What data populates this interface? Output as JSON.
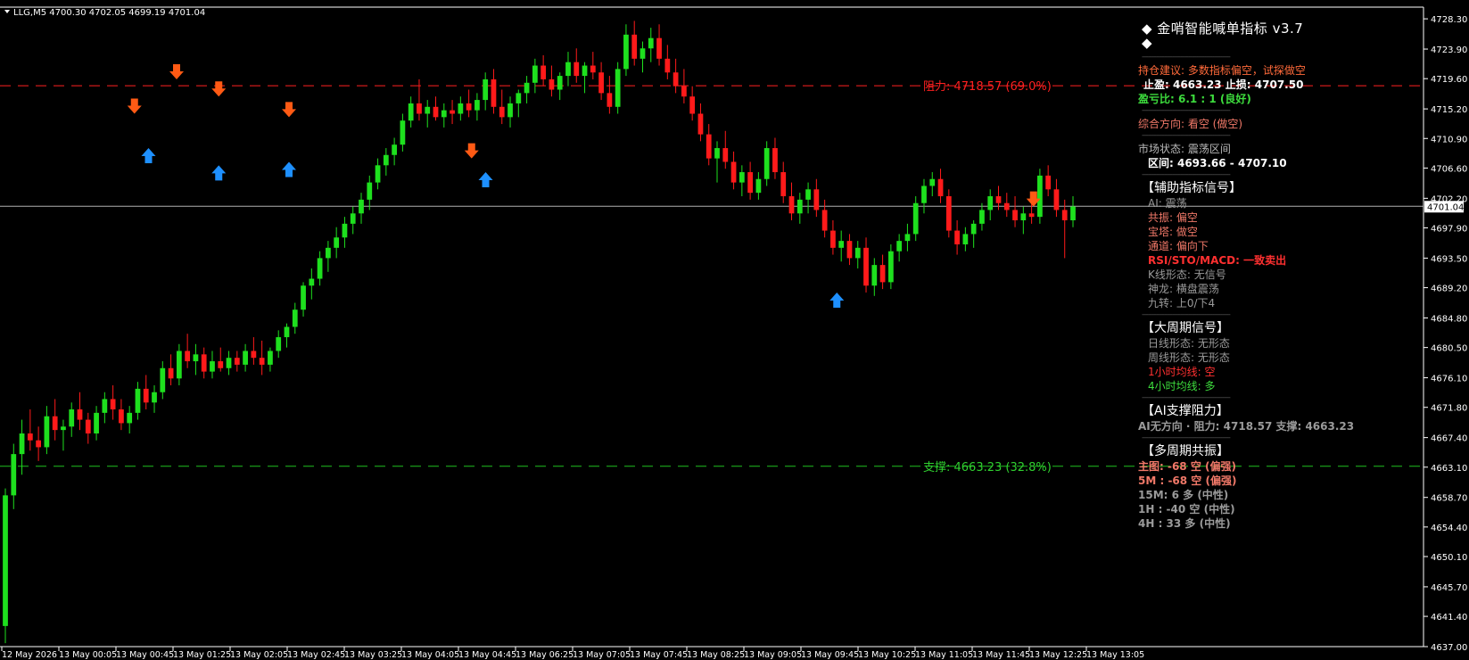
{
  "header": {
    "symbol_info": "LLG,M5  4700.30 4702.05 4699.19 4701.04"
  },
  "price_axis": {
    "ticks": [
      "4728.30",
      "4723.90",
      "4719.60",
      "4715.20",
      "4710.90",
      "4706.60",
      "4702.20",
      "4697.90",
      "4693.50",
      "4689.20",
      "4684.80",
      "4680.50",
      "4676.10",
      "4671.80",
      "4667.40",
      "4663.10",
      "4658.70",
      "4654.40",
      "4650.10",
      "4645.70",
      "4641.40",
      "4637.00"
    ],
    "current_price_label": "4701.04"
  },
  "time_axis": {
    "labels": [
      "12 May 2026",
      "13 May 00:05",
      "13 May 00:45",
      "13 May 01:25",
      "13 May 02:05",
      "13 May 02:45",
      "13 May 03:25",
      "13 May 04:05",
      "13 May 04:45",
      "13 May 06:25",
      "13 May 07:05",
      "13 May 07:45",
      "13 May 08:25",
      "13 May 09:05",
      "13 May 09:45",
      "13 May 10:25",
      "13 May 11:05",
      "13 May 11:45",
      "13 May 12:25",
      "13 May 13:05"
    ]
  },
  "levels": {
    "resistance_label": "阻力: 4718.57 (69.0%)",
    "support_label": "支撑: 4663.23 (32.8%)"
  },
  "colors": {
    "bull": "#1ee01e",
    "bear": "#ff1a1a",
    "resistance": "#ff2020",
    "support": "#20c020",
    "arrow_up": "#1e90ff",
    "arrow_down": "#ff5a14",
    "grid_axis": "#ffffff"
  },
  "panel": {
    "title": "◆ 金哨智能喊单指标 v3.7 ◆",
    "position_advice": "持仓建议: 多数指标偏空，试探做空",
    "tp_sl": "止盈: 4663.23  止损: 4707.50",
    "rr_ratio": "盈亏比: 6.1 : 1 (良好)",
    "overall_direction": "综合方向: 看空 (做空)",
    "market_state": "市场状态: 震荡区间",
    "range": "区间: 4693.66 - 4707.10",
    "aux_head": "【辅助指标信号】",
    "aux": {
      "ai": "AI: 震荡",
      "resonance": "共振: 偏空",
      "tower": "宝塔: 做空",
      "channel": "通道: 偏向下",
      "rsi": "RSI/STO/MACD: 一致卖出",
      "kline": "K线形态: 无信号",
      "dragon": "神龙: 横盘震荡",
      "nine": "九转: 上0/下4"
    },
    "big_head": "【大周期信号】",
    "big": {
      "daily": "日线形态: 无形态",
      "weekly": "周线形态: 无形态",
      "h1ma": "1小时均线: 空",
      "h4ma": "4小时均线: 多"
    },
    "ai_head": "【AI支撑阻力】",
    "ai_line": "AI无方向 · 阻力: 4718.57   支撑: 4663.23",
    "multi_head": "【多周期共振】",
    "multi": {
      "main": "主图: -68 空 (偏强)",
      "m5": "5M : -68 空 (偏强)",
      "m15": "15M: 6 多 (中性)",
      "h1": "1H : -40 空 (中性)",
      "h4": "4H : 33 多 (中性)"
    }
  },
  "chart_data": {
    "type": "candlestick",
    "symbol": "LLG",
    "timeframe": "M5",
    "ylim": [
      4637.0,
      4730.0
    ],
    "resistance": 4718.57,
    "support": 4663.23,
    "current": 4701.04,
    "candles": [
      [
        4640.0,
        4660.0,
        4637.5,
        4659.0
      ],
      [
        4659.0,
        4666.5,
        4657.0,
        4665.0
      ],
      [
        4665.0,
        4670.0,
        4662.0,
        4668.0
      ],
      [
        4668.0,
        4671.5,
        4665.5,
        4667.0
      ],
      [
        4667.0,
        4669.0,
        4664.0,
        4666.0
      ],
      [
        4666.0,
        4672.0,
        4665.0,
        4670.5
      ],
      [
        4670.5,
        4673.0,
        4667.0,
        4668.5
      ],
      [
        4668.5,
        4670.0,
        4665.5,
        4669.0
      ],
      [
        4669.0,
        4672.5,
        4667.5,
        4671.5
      ],
      [
        4671.5,
        4674.0,
        4668.5,
        4670.0
      ],
      [
        4670.0,
        4671.0,
        4666.5,
        4668.0
      ],
      [
        4668.0,
        4672.0,
        4667.0,
        4671.0
      ],
      [
        4671.0,
        4674.0,
        4669.5,
        4673.0
      ],
      [
        4673.0,
        4675.0,
        4670.0,
        4671.5
      ],
      [
        4671.5,
        4673.0,
        4668.5,
        4669.5
      ],
      [
        4669.5,
        4672.0,
        4668.0,
        4671.0
      ],
      [
        4671.0,
        4675.5,
        4670.0,
        4674.5
      ],
      [
        4674.5,
        4676.5,
        4671.5,
        4672.5
      ],
      [
        4672.5,
        4675.0,
        4671.0,
        4674.0
      ],
      [
        4674.0,
        4678.5,
        4673.0,
        4677.5
      ],
      [
        4677.5,
        4679.5,
        4675.0,
        4676.0
      ],
      [
        4676.0,
        4681.0,
        4675.0,
        4680.0
      ],
      [
        4680.0,
        4682.5,
        4677.5,
        4678.5
      ],
      [
        4678.5,
        4681.0,
        4676.5,
        4679.5
      ],
      [
        4679.5,
        4680.5,
        4676.0,
        4677.0
      ],
      [
        4677.0,
        4680.0,
        4676.0,
        4678.5
      ],
      [
        4678.5,
        4680.5,
        4677.0,
        4677.5
      ],
      [
        4677.5,
        4680.0,
        4676.5,
        4679.0
      ],
      [
        4679.0,
        4680.0,
        4677.0,
        4678.0
      ],
      [
        4678.0,
        4681.0,
        4677.0,
        4680.0
      ],
      [
        4680.0,
        4682.0,
        4678.0,
        4679.0
      ],
      [
        4679.0,
        4681.5,
        4676.5,
        4678.0
      ],
      [
        4678.0,
        4680.5,
        4677.0,
        4680.0
      ],
      [
        4680.0,
        4683.0,
        4679.0,
        4682.0
      ],
      [
        4682.0,
        4684.0,
        4680.5,
        4683.5
      ],
      [
        4683.5,
        4687.0,
        4682.5,
        4686.0
      ],
      [
        4686.0,
        4690.0,
        4685.0,
        4689.5
      ],
      [
        4689.5,
        4692.0,
        4687.5,
        4690.5
      ],
      [
        4690.5,
        4694.5,
        4689.5,
        4693.5
      ],
      [
        4693.5,
        4696.0,
        4691.5,
        4695.0
      ],
      [
        4695.0,
        4698.0,
        4693.5,
        4696.5
      ],
      [
        4696.5,
        4699.5,
        4695.0,
        4698.5
      ],
      [
        4698.5,
        4701.0,
        4697.0,
        4700.0
      ],
      [
        4700.0,
        4703.0,
        4698.5,
        4702.0
      ],
      [
        4702.0,
        4705.5,
        4700.5,
        4704.5
      ],
      [
        4704.5,
        4708.0,
        4703.5,
        4707.0
      ],
      [
        4707.0,
        4709.5,
        4705.5,
        4708.5
      ],
      [
        4708.5,
        4711.0,
        4707.0,
        4710.0
      ],
      [
        4710.0,
        4714.5,
        4709.0,
        4713.5
      ],
      [
        4713.5,
        4717.0,
        4712.5,
        4716.0
      ],
      [
        4716.0,
        4719.5,
        4713.5,
        4714.5
      ],
      [
        4714.5,
        4716.5,
        4712.5,
        4715.5
      ],
      [
        4715.5,
        4717.0,
        4713.5,
        4714.0
      ],
      [
        4714.0,
        4716.0,
        4712.5,
        4715.0
      ],
      [
        4715.0,
        4716.5,
        4713.0,
        4714.5
      ],
      [
        4714.5,
        4717.0,
        4713.5,
        4716.0
      ],
      [
        4716.0,
        4718.0,
        4714.0,
        4715.0
      ],
      [
        4715.0,
        4717.5,
        4713.5,
        4716.5
      ],
      [
        4716.5,
        4720.5,
        4715.0,
        4719.5
      ],
      [
        4719.5,
        4721.0,
        4714.5,
        4715.5
      ],
      [
        4715.5,
        4718.0,
        4713.0,
        4714.0
      ],
      [
        4714.0,
        4717.0,
        4712.5,
        4716.0
      ],
      [
        4716.0,
        4718.0,
        4714.0,
        4717.5
      ],
      [
        4717.5,
        4720.0,
        4716.0,
        4719.0
      ],
      [
        4719.0,
        4722.5,
        4717.5,
        4721.5
      ],
      [
        4721.5,
        4723.0,
        4718.5,
        4719.5
      ],
      [
        4719.5,
        4721.5,
        4717.0,
        4718.0
      ],
      [
        4718.0,
        4720.5,
        4716.5,
        4720.0
      ],
      [
        4720.0,
        4723.5,
        4718.5,
        4722.0
      ],
      [
        4722.0,
        4724.0,
        4719.0,
        4720.0
      ],
      [
        4720.0,
        4722.0,
        4717.5,
        4721.5
      ],
      [
        4721.5,
        4723.5,
        4719.5,
        4720.5
      ],
      [
        4720.5,
        4722.0,
        4716.5,
        4717.5
      ],
      [
        4717.5,
        4720.0,
        4714.5,
        4715.5
      ],
      [
        4715.5,
        4722.0,
        4714.5,
        4721.0
      ],
      [
        4721.0,
        4727.5,
        4720.0,
        4726.0
      ],
      [
        4726.0,
        4728.0,
        4721.5,
        4722.5
      ],
      [
        4722.5,
        4725.0,
        4720.5,
        4724.0
      ],
      [
        4724.0,
        4727.0,
        4722.0,
        4725.5
      ],
      [
        4725.5,
        4727.5,
        4721.5,
        4722.5
      ],
      [
        4722.5,
        4724.5,
        4719.5,
        4720.5
      ],
      [
        4720.5,
        4722.5,
        4717.5,
        4718.5
      ],
      [
        4718.5,
        4721.0,
        4716.0,
        4717.0
      ],
      [
        4717.0,
        4718.5,
        4713.5,
        4714.5
      ],
      [
        4714.5,
        4716.0,
        4710.5,
        4711.5
      ],
      [
        4711.5,
        4713.0,
        4707.0,
        4708.0
      ],
      [
        4708.0,
        4710.5,
        4704.5,
        4709.5
      ],
      [
        4709.5,
        4712.0,
        4706.5,
        4707.5
      ],
      [
        4707.5,
        4709.0,
        4703.5,
        4704.5
      ],
      [
        4704.5,
        4707.0,
        4702.5,
        4706.0
      ],
      [
        4706.0,
        4707.5,
        4702.0,
        4703.0
      ],
      [
        4703.0,
        4706.0,
        4702.0,
        4705.0
      ],
      [
        4705.0,
        4710.5,
        4704.0,
        4709.5
      ],
      [
        4709.5,
        4711.0,
        4705.0,
        4706.0
      ],
      [
        4706.0,
        4707.5,
        4701.5,
        4702.5
      ],
      [
        4702.5,
        4704.5,
        4699.0,
        4700.0
      ],
      [
        4700.0,
        4703.0,
        4698.5,
        4702.0
      ],
      [
        4702.0,
        4704.5,
        4700.0,
        4703.5
      ],
      [
        4703.5,
        4705.0,
        4699.5,
        4700.5
      ],
      [
        4700.5,
        4702.0,
        4696.5,
        4697.5
      ],
      [
        4697.5,
        4699.0,
        4694.0,
        4695.0
      ],
      [
        4695.0,
        4697.5,
        4693.0,
        4696.0
      ],
      [
        4696.0,
        4697.0,
        4692.5,
        4693.5
      ],
      [
        4693.5,
        4696.0,
        4692.0,
        4695.0
      ],
      [
        4695.0,
        4696.5,
        4688.5,
        4689.5
      ],
      [
        4689.5,
        4693.5,
        4688.0,
        4692.5
      ],
      [
        4692.5,
        4694.0,
        4689.0,
        4690.0
      ],
      [
        4690.0,
        4695.5,
        4689.0,
        4694.5
      ],
      [
        4694.5,
        4697.0,
        4693.0,
        4696.0
      ],
      [
        4696.0,
        4698.5,
        4694.5,
        4697.0
      ],
      [
        4697.0,
        4702.5,
        4696.0,
        4701.5
      ],
      [
        4701.5,
        4705.0,
        4700.0,
        4704.0
      ],
      [
        4704.0,
        4706.0,
        4702.5,
        4705.0
      ],
      [
        4705.0,
        4706.5,
        4701.5,
        4702.5
      ],
      [
        4702.5,
        4703.5,
        4696.5,
        4697.5
      ],
      [
        4697.5,
        4699.0,
        4694.0,
        4695.5
      ],
      [
        4695.5,
        4698.0,
        4694.5,
        4697.0
      ],
      [
        4697.0,
        4699.0,
        4695.0,
        4698.5
      ],
      [
        4698.5,
        4701.5,
        4697.5,
        4700.5
      ],
      [
        4700.5,
        4703.5,
        4699.0,
        4702.5
      ],
      [
        4702.5,
        4704.0,
        4700.5,
        4701.5
      ],
      [
        4701.5,
        4703.0,
        4699.5,
        4700.5
      ],
      [
        4700.5,
        4702.5,
        4698.0,
        4699.0
      ],
      [
        4699.0,
        4701.0,
        4697.0,
        4700.0
      ],
      [
        4700.0,
        4702.0,
        4698.5,
        4699.5
      ],
      [
        4699.5,
        4706.5,
        4698.5,
        4705.5
      ],
      [
        4705.5,
        4707.0,
        4702.5,
        4703.5
      ],
      [
        4703.5,
        4705.0,
        4699.5,
        4700.5
      ],
      [
        4700.5,
        4702.0,
        4693.5,
        4699.0
      ],
      [
        4699.0,
        4702.5,
        4698.0,
        4701.0
      ]
    ],
    "signals_up": [
      [
        10,
        4709.5
      ],
      [
        15,
        4707.0
      ],
      [
        20,
        4707.5
      ],
      [
        34,
        4706.0
      ],
      [
        59,
        4688.5
      ]
    ],
    "signals_down": [
      [
        9,
        4714.5
      ],
      [
        12,
        4719.5
      ],
      [
        15,
        4717.0
      ],
      [
        20,
        4714.0
      ],
      [
        33,
        4708.0
      ],
      [
        73,
        4701.0
      ]
    ]
  }
}
